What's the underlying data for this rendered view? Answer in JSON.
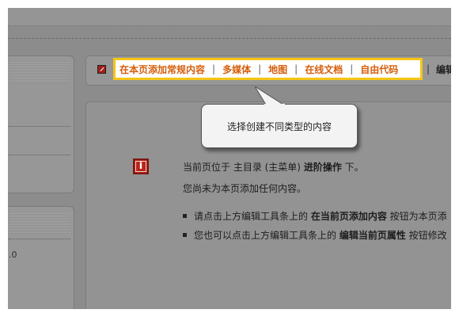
{
  "toolbar": {
    "items": [
      {
        "label": "在本页添加常规内容"
      },
      {
        "label": "多媒体"
      },
      {
        "label": "地图"
      },
      {
        "label": "在线文档"
      },
      {
        "label": "自由代码"
      }
    ],
    "separator": "|",
    "more_label": "编辑",
    "highlight_color": "#f5c515",
    "link_color": "#d55e0c"
  },
  "tooltip": {
    "text": "选择创建不同类型的内容"
  },
  "sidebar": {
    "value_text": ".0"
  },
  "content": {
    "info_icon": "info-icon",
    "line1": {
      "prefix": "当前页位于 主目录 (主菜单) ",
      "bold": "进阶操作",
      "suffix": " 下。"
    },
    "line2": "您尚未为本页添加任何内容。",
    "bullets": [
      {
        "prefix": "请点击上方编辑工具条上的 ",
        "bold": "在当前页添加内容",
        "suffix": " 按钮为本页添"
      },
      {
        "prefix": "您也可以点击上方编辑工具条上的 ",
        "bold": "编辑当前页属性",
        "suffix": " 按钮修改"
      }
    ]
  }
}
